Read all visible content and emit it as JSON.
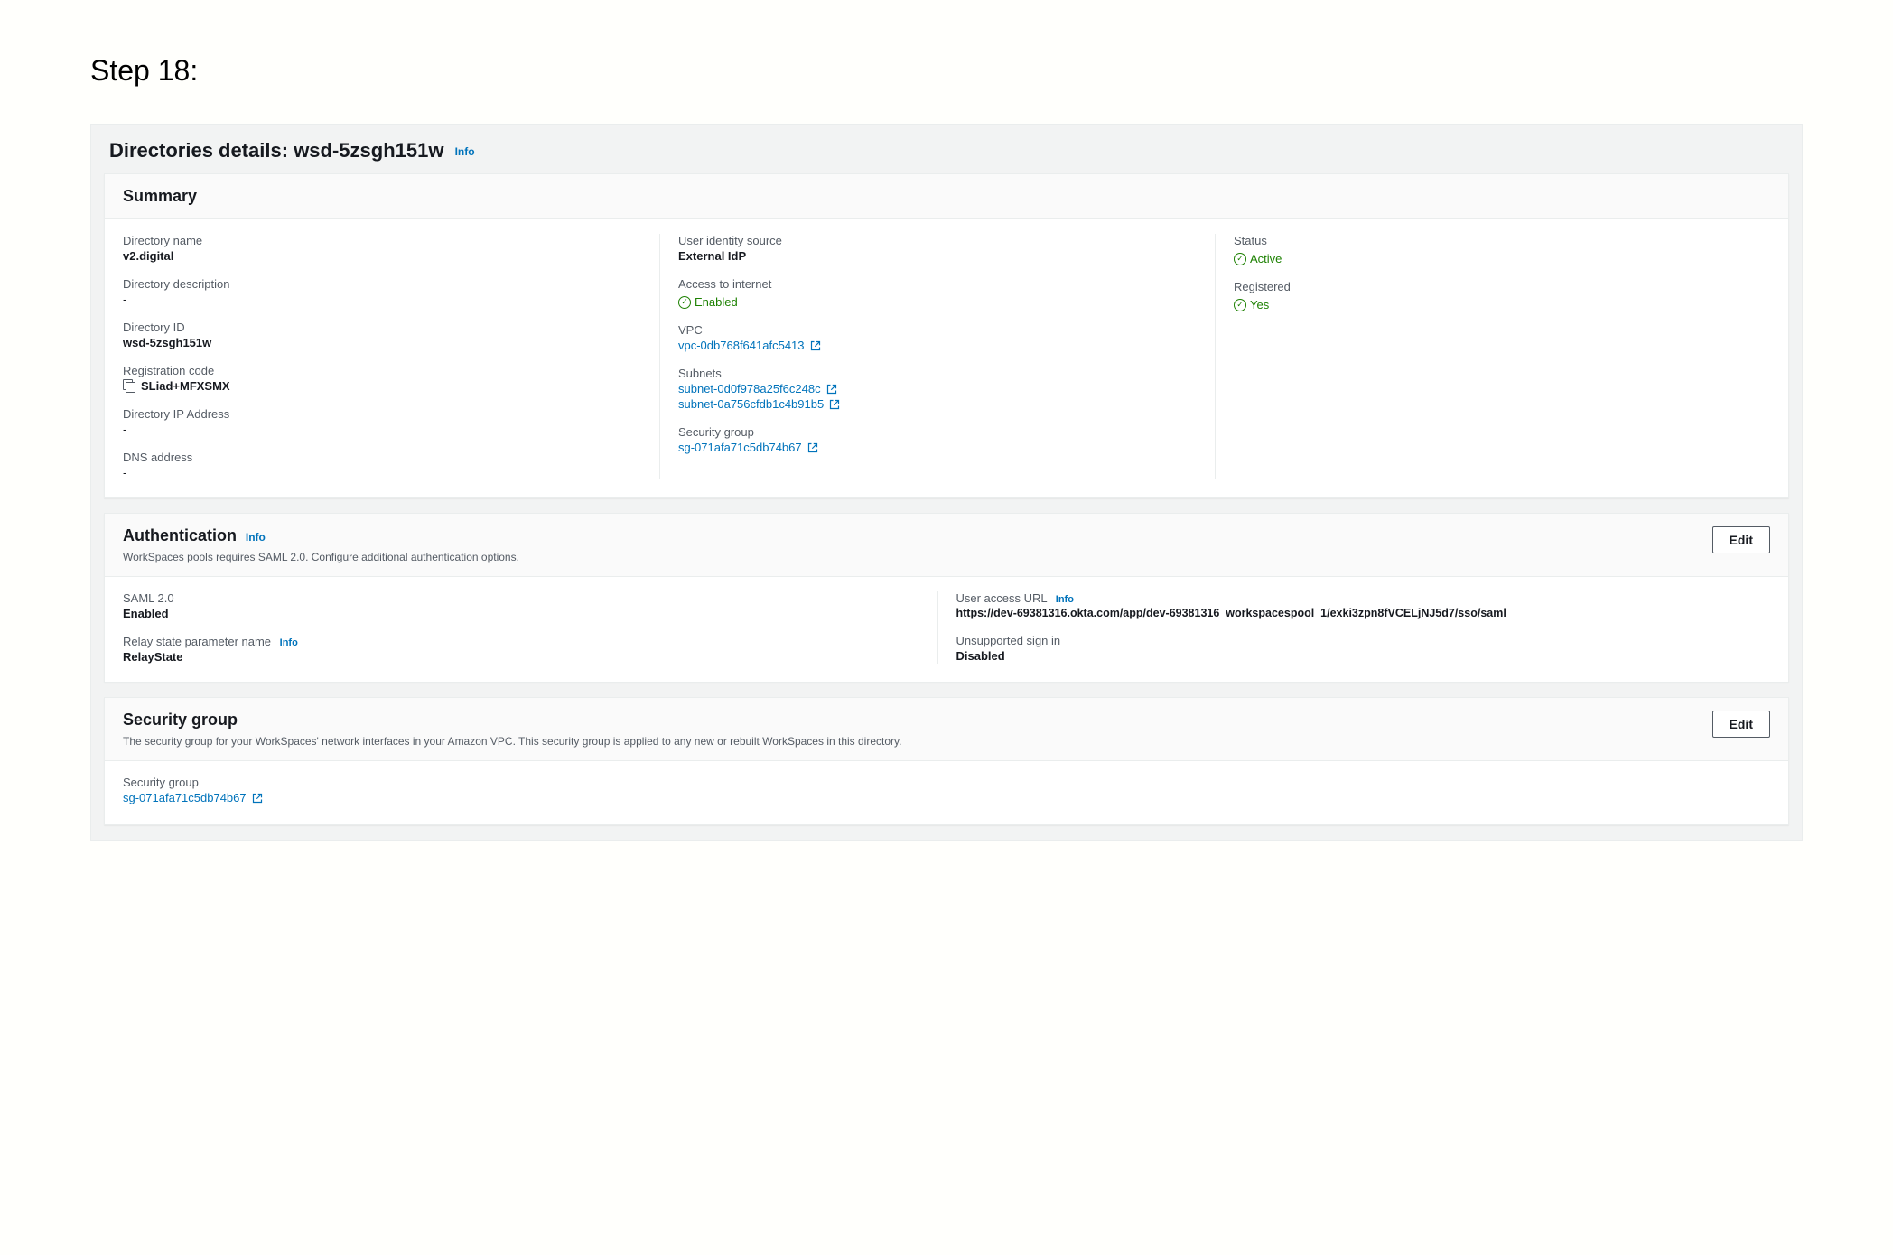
{
  "step_label": "Step 18:",
  "page_title": "Directories details: wsd-5zsgh151w",
  "info_label": "Info",
  "edit_label": "Edit",
  "summary": {
    "title": "Summary",
    "col1": {
      "directory_name": {
        "label": "Directory name",
        "value": "v2.digital"
      },
      "directory_description": {
        "label": "Directory description",
        "value": "-"
      },
      "directory_id": {
        "label": "Directory ID",
        "value": "wsd-5zsgh151w"
      },
      "registration_code": {
        "label": "Registration code",
        "value": "SLiad+MFXSMX"
      },
      "directory_ip": {
        "label": "Directory IP Address",
        "value": "-"
      },
      "dns_address": {
        "label": "DNS address",
        "value": "-"
      }
    },
    "col2": {
      "user_identity_source": {
        "label": "User identity source",
        "value": "External IdP"
      },
      "access_to_internet": {
        "label": "Access to internet",
        "value": "Enabled"
      },
      "vpc": {
        "label": "VPC",
        "value": "vpc-0db768f641afc5413"
      },
      "subnets": {
        "label": "Subnets",
        "values": [
          "subnet-0d0f978a25f6c248c",
          "subnet-0a756cfdb1c4b91b5"
        ]
      },
      "security_group": {
        "label": "Security group",
        "value": "sg-071afa71c5db74b67"
      }
    },
    "col3": {
      "status": {
        "label": "Status",
        "value": "Active"
      },
      "registered": {
        "label": "Registered",
        "value": "Yes"
      }
    }
  },
  "authentication": {
    "title": "Authentication",
    "subtitle": "WorkSpaces pools requires SAML 2.0. Configure additional authentication options.",
    "col1": {
      "saml": {
        "label": "SAML 2.0",
        "value": "Enabled"
      },
      "relay_state": {
        "label": "Relay state parameter name",
        "value": "RelayState"
      }
    },
    "col2": {
      "user_access_url": {
        "label": "User access URL",
        "value": "https://dev-69381316.okta.com/app/dev-69381316_workspacespool_1/exki3zpn8fVCELjNJ5d7/sso/saml"
      },
      "unsupported_sign_in": {
        "label": "Unsupported sign in",
        "value": "Disabled"
      }
    }
  },
  "security_group": {
    "title": "Security group",
    "subtitle": "The security group for your WorkSpaces' network interfaces in your Amazon VPC. This security group is applied to any new or rebuilt WorkSpaces in this directory.",
    "field": {
      "label": "Security group",
      "value": "sg-071afa71c5db74b67"
    }
  }
}
